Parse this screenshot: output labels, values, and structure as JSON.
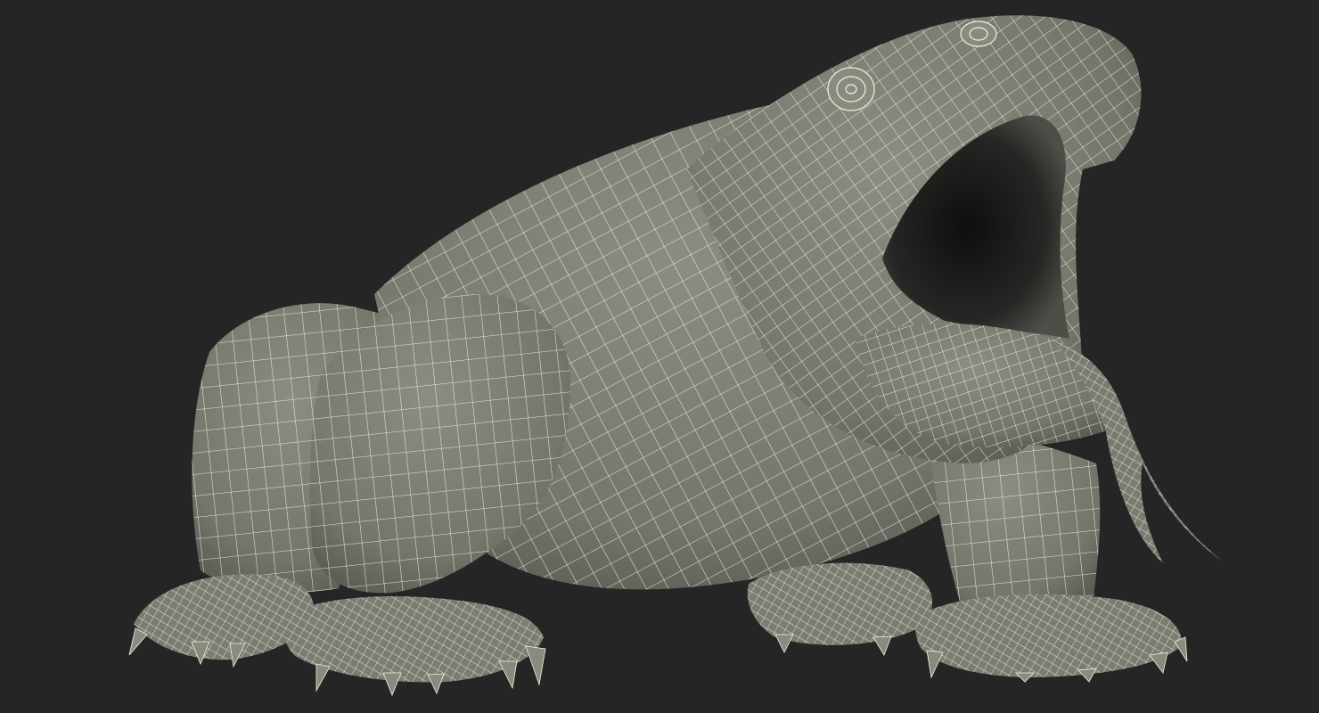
{
  "scene": {
    "subject": "komodo-dragon-wireframe-model",
    "background_color": "#252525",
    "mesh_fill_color": "#7d7e74",
    "mesh_shadow_color": "#4a4b45",
    "mesh_highlight_color": "#9a9b90",
    "wire_color": "#f4f2dc",
    "mouth_interior_color": "#151515"
  }
}
